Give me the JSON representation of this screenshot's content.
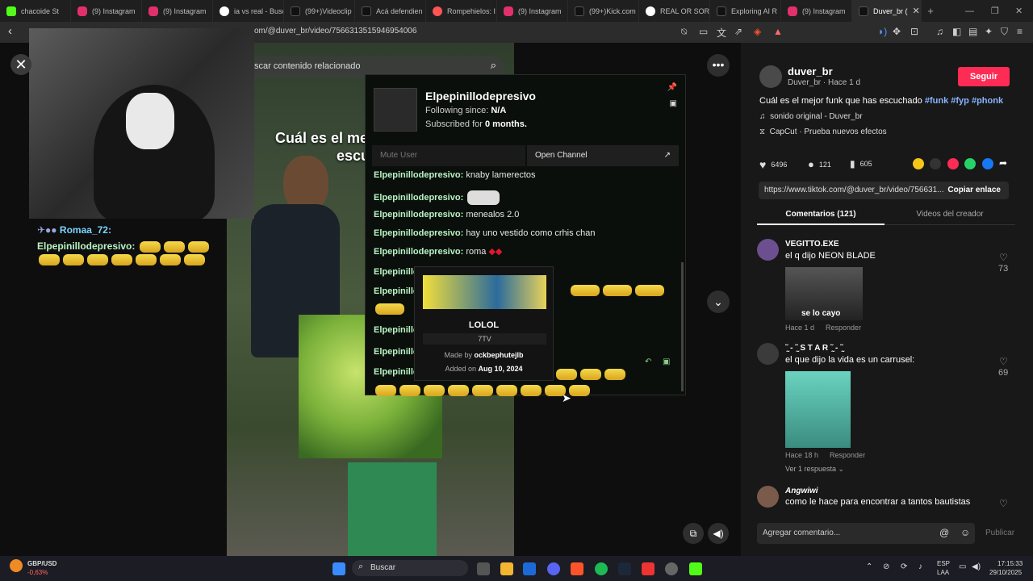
{
  "browser": {
    "tabs": [
      {
        "label": "chacoide St",
        "color": "#53fc18"
      },
      {
        "label": "(9) Instagram",
        "color": "#e1306c"
      },
      {
        "label": "(9) Instagram",
        "color": "#e1306c"
      },
      {
        "label": "ia vs real - Busc",
        "color": "#4285f4"
      },
      {
        "label": "(99+)Videoclip",
        "color": "#ffffff"
      },
      {
        "label": "Acá defendien",
        "color": "#ffffff"
      },
      {
        "label": "Rompehielos: I",
        "color": "#ff5555"
      },
      {
        "label": "(9) Instagram",
        "color": "#e1306c"
      },
      {
        "label": "(99+)Kick.com",
        "color": "#ffffff"
      },
      {
        "label": "REAL OR SORA",
        "color": "#4285f4"
      },
      {
        "label": "Exploring AI R",
        "color": "#ffffff"
      },
      {
        "label": "(9) Instagram",
        "color": "#e1306c"
      },
      {
        "label": "Duver_br (",
        "color": "#ffffff"
      }
    ],
    "url": "om/@duver_br/video/7566313515946954006"
  },
  "video": {
    "search_placeholder": "scar contenido relacionado",
    "caption_line1": "Cuál es el mej",
    "caption_line2": "escu"
  },
  "left_chat": {
    "user1": "Romaa_72:",
    "user2": "Elpepinillodepresivo:"
  },
  "popup": {
    "username": "Elpepinillodepresivo",
    "following_label": "Following since:",
    "following_value": "N/A",
    "subscribed_label": "Subscribed for",
    "subscribed_value": "0 months.",
    "mute": "Mute User",
    "open_channel": "Open Channel",
    "messages": [
      {
        "name": "Elpepinillodepresivo:",
        "text": "knaby lamerectos"
      },
      {
        "name": "Elpepinillodepresivo:",
        "text": ""
      },
      {
        "name": "Elpepinillodepresivo:",
        "text": "menealos 2.0"
      },
      {
        "name": "Elpepinillodepresivo:",
        "text": "hay uno vestido como crhis chan"
      },
      {
        "name": "Elpepinillodepresivo:",
        "text": "roma"
      },
      {
        "name": "Elpepinillo",
        "text": ""
      },
      {
        "name": "Elpepinillo",
        "text": ""
      },
      {
        "name": "Elpepinillo",
        "text": ""
      },
      {
        "name": "Elpepinillo",
        "text": ""
      },
      {
        "name": "Elpepinillo",
        "text": ""
      }
    ]
  },
  "emote_card": {
    "name": "LOLOL",
    "provider": "7TV",
    "made_by_label": "Made by",
    "made_by": "ockbephutejlb",
    "added_label": "Added on",
    "added": "Aug 10, 2024"
  },
  "right": {
    "username": "duver_br",
    "subline": "Duver_br · Hace 1 d",
    "follow": "Seguir",
    "desc": "Cuál es el mejor funk que has escuchado",
    "tags": [
      "#funk",
      "#fyp",
      "#phonk"
    ],
    "sound": "sonido original - Duver_br",
    "capcut": "CapCut · Prueba nuevos efectos",
    "stats": {
      "likes": "6496",
      "comments": "121",
      "saves": "605"
    },
    "link": "https://www.tiktok.com/@duver_br/video/756631...",
    "copy": "Copiar enlace",
    "tab_comments": "Comentarios (121)",
    "tab_videos": "Videos del creador",
    "comments": [
      {
        "name": "VEGITTO.EXE",
        "text": "el q dijo NEON BLADE",
        "meta": "Hace 1 d",
        "reply": "Responder",
        "likes": "73",
        "image_text": "se lo cayo"
      },
      {
        "name": "˜̰ - ˜̰ S T A R ˜̰ - ˜̰",
        "text": "el que dijo la vida es un carrusel:",
        "meta": "Hace 18 h",
        "reply": "Responder",
        "likes": "69",
        "more": "Ver 1 respuesta"
      },
      {
        "name": "Angwiwi",
        "text": "como le hace para encontrar a tantos bautistas",
        "likes": ""
      }
    ],
    "comment_placeholder": "Agregar comentario...",
    "publish": "Publicar"
  },
  "taskbar": {
    "ticker_name": "GBP/USD",
    "ticker_change": "-0,63%",
    "search": "Buscar",
    "lang1": "ESP",
    "lang2": "LAA",
    "time": "17:15:33",
    "date": "29/10/2025"
  }
}
